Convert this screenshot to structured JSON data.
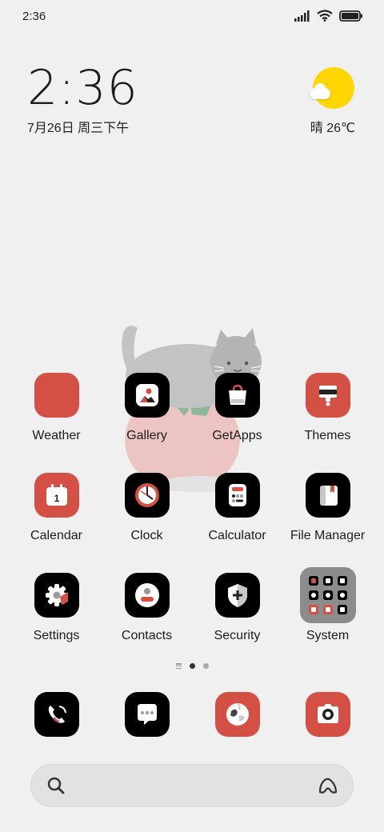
{
  "status_bar": {
    "time": "2:36",
    "icons": [
      "signal-icon",
      "wifi-icon",
      "battery-icon"
    ]
  },
  "clock_widget": {
    "time": "2:36",
    "date": "7月26日 周三下午"
  },
  "weather_widget": {
    "condition_icon": "sun-cloud-icon",
    "text": "晴 26℃"
  },
  "apps": [
    [
      {
        "label": "Weather",
        "icon": "weather-icon"
      },
      {
        "label": "Gallery",
        "icon": "gallery-icon"
      },
      {
        "label": "GetApps",
        "icon": "getapps-icon"
      },
      {
        "label": "Themes",
        "icon": "themes-icon"
      }
    ],
    [
      {
        "label": "Calendar",
        "icon": "calendar-icon",
        "day": "1"
      },
      {
        "label": "Clock",
        "icon": "clock-icon"
      },
      {
        "label": "Calculator",
        "icon": "calculator-icon"
      },
      {
        "label": "File Manager",
        "icon": "file-manager-icon"
      }
    ],
    [
      {
        "label": "Settings",
        "icon": "settings-icon"
      },
      {
        "label": "Contacts",
        "icon": "contacts-icon"
      },
      {
        "label": "Security",
        "icon": "security-icon"
      },
      {
        "label": "System",
        "icon": "system-folder-icon"
      }
    ]
  ],
  "page_indicator": {
    "pages": 2,
    "active": 0
  },
  "dock": [
    {
      "icon": "phone-icon"
    },
    {
      "icon": "messages-icon"
    },
    {
      "icon": "browser-icon"
    },
    {
      "icon": "camera-icon"
    }
  ],
  "search_bar": {
    "search_icon": "search-icon",
    "assistant_icon": "assistant-icon"
  },
  "colors": {
    "background": "#f0f0f0",
    "accent_red": "#d44f44",
    "icon_black": "#000000",
    "sun_yellow": "#ffd600"
  }
}
